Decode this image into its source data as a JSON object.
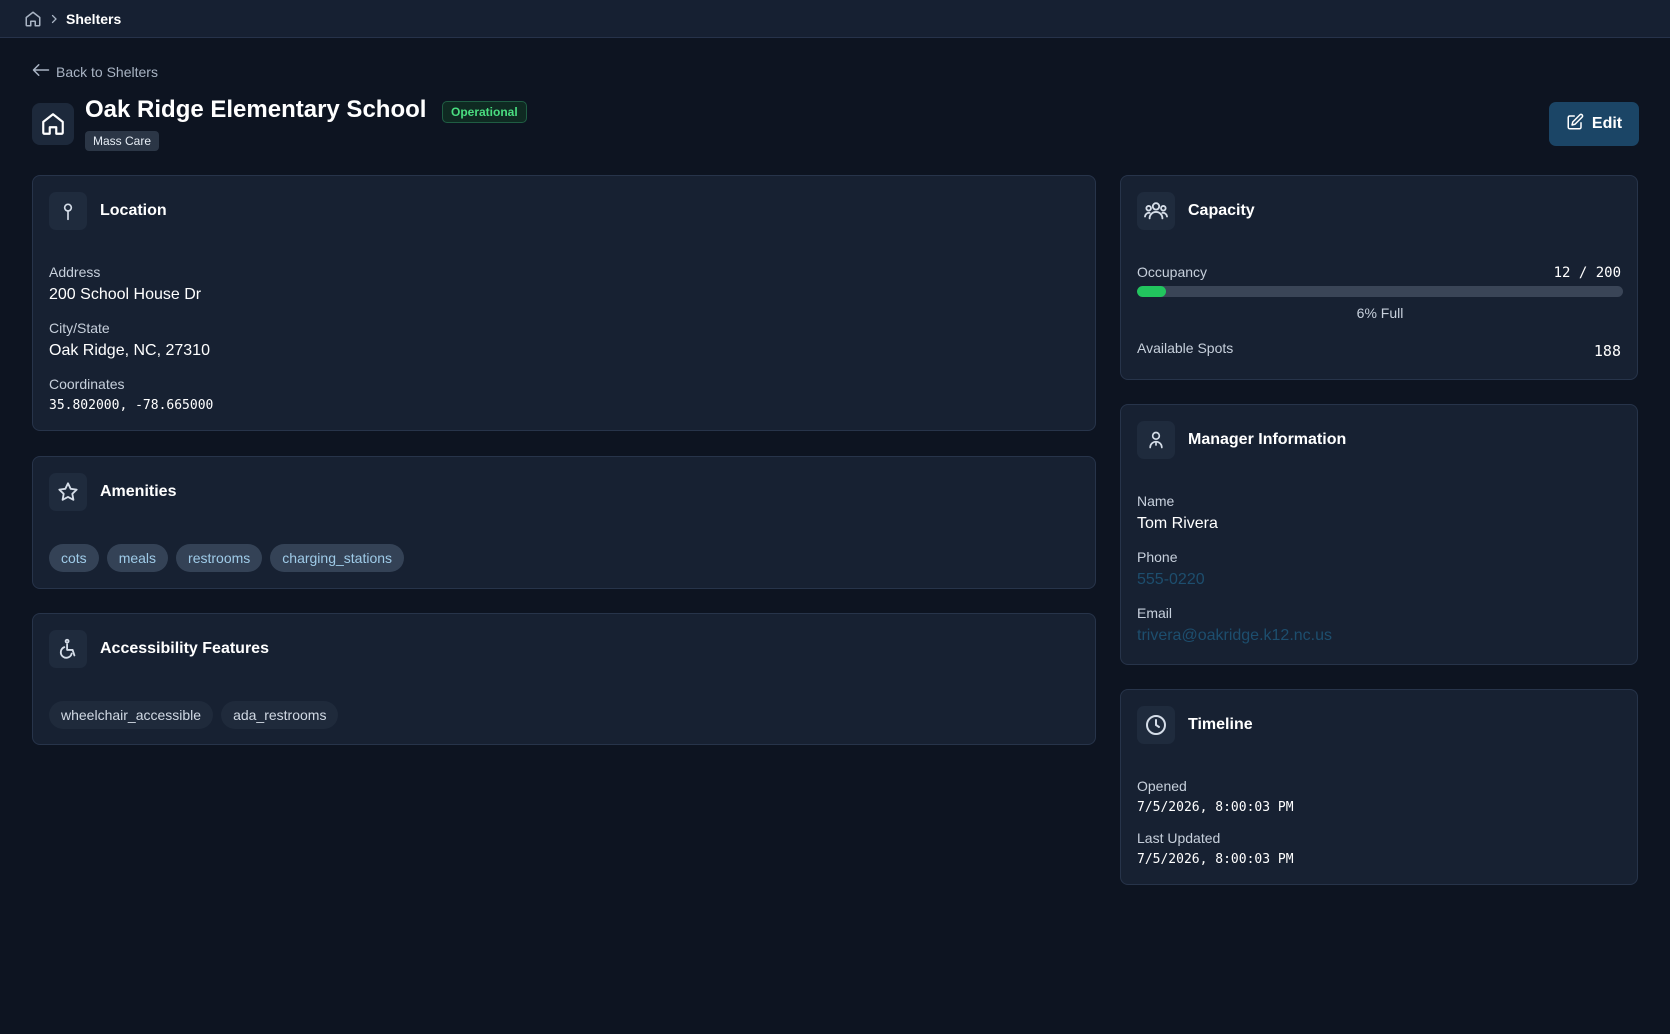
{
  "breadcrumb": {
    "home_icon": "home-icon",
    "separator_icon": "chevron-right-icon",
    "current": "Shelters"
  },
  "back_link": {
    "label": "Back to Shelters",
    "icon": "arrow-left-icon"
  },
  "shelter": {
    "icon": "home-icon",
    "name": "Oak Ridge Elementary School",
    "status": "Operational",
    "type": "Mass Care"
  },
  "edit_button": {
    "label": "Edit",
    "icon": "edit-icon"
  },
  "location": {
    "title": "Location",
    "icon": "map-pin-icon",
    "address_label": "Address",
    "address": "200 School House Dr",
    "city_label": "City/State",
    "city": "Oak Ridge, NC, 27310",
    "coords_label": "Coordinates",
    "coords": "35.802000, -78.665000"
  },
  "amenities": {
    "title": "Amenities",
    "icon": "star-icon",
    "items": [
      "cots",
      "meals",
      "restrooms",
      "charging_stations"
    ]
  },
  "accessibility": {
    "title": "Accessibility Features",
    "icon": "wheelchair-icon",
    "items": [
      "wheelchair_accessible",
      "ada_restrooms"
    ]
  },
  "capacity": {
    "title": "Capacity",
    "icon": "users-icon",
    "occupancy_label": "Occupancy",
    "occupancy_value": "12 / 200",
    "occupancy_fraction": 0.06,
    "percent_text": "6% Full",
    "available_label": "Available Spots",
    "available_value": "188"
  },
  "manager": {
    "title": "Manager Information",
    "icon": "user-icon",
    "name_label": "Name",
    "name": "Tom Rivera",
    "phone_label": "Phone",
    "phone": "555-0220",
    "email_label": "Email",
    "email": "trivera@oakridge.k12.nc.us"
  },
  "timeline": {
    "title": "Timeline",
    "icon": "clock-icon",
    "opened_label": "Opened",
    "opened": "7/5/2026, 8:00:03 PM",
    "updated_label": "Last Updated",
    "updated": "7/5/2026, 8:00:03 PM"
  },
  "colors": {
    "background": "#0d1421",
    "card": "#172132",
    "accent_button": "#1b4566",
    "status_green": "#4ade80",
    "progress_green": "#22c55e",
    "link": "#1d4e6e"
  }
}
